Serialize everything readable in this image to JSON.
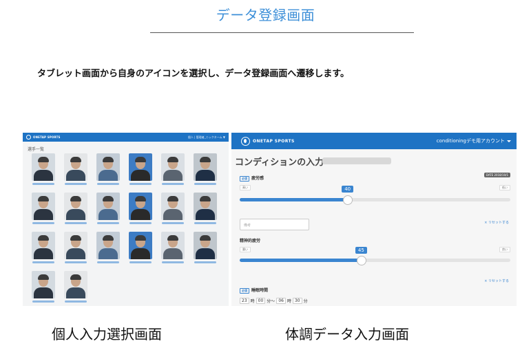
{
  "header": {
    "title": "データ登録画面",
    "description": "タブレット画面から自身のアイコンを選択し、データ登録画面へ遷移します。"
  },
  "left_screen": {
    "logo_text": "ONETAP SPORTS",
    "account": "個人 | 管理者_ニックネーム ▼",
    "list_title": "選手一覧",
    "athlete_count": 20,
    "caption": "個人入力選択画面"
  },
  "right_screen": {
    "logo_text": "ONETAP SPORTS",
    "account": "conditioningデモ用アカウント",
    "heading": "コンディションの入力",
    "date_badge": "DATE 2018/10/1",
    "required_label": "必須",
    "fatigue": {
      "label": "疲労感",
      "low": "高い",
      "high": "低い",
      "value": 40
    },
    "memo_placeholder": "備考",
    "reset_label": "× リセットする",
    "mental": {
      "label": "精神的疲労",
      "low": "悪い",
      "high": "良い",
      "value": 45
    },
    "sleep": {
      "label": "睡眠時間",
      "start_hour": "23",
      "start_min": "00",
      "end_hour": "06",
      "end_min": "30",
      "hour_unit": "時",
      "min_unit": "分",
      "range_sep": "分〜",
      "min_unit_end": "分"
    },
    "caption": "体調データ入力画面"
  },
  "colors": {
    "accent": "#3d8fd8",
    "topbar": "#1e73c4",
    "slider": "#3a85d0"
  }
}
